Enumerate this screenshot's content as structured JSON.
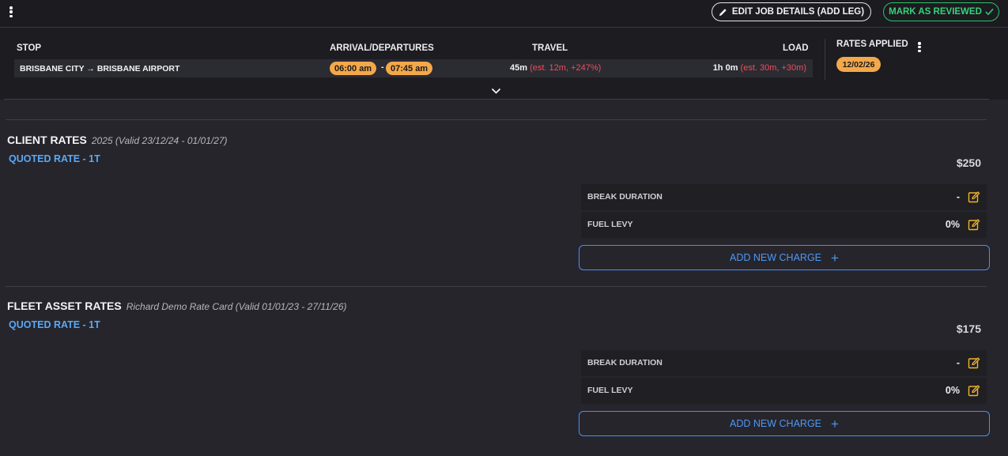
{
  "toolbar": {
    "edit_label": "EDIT JOB DETAILS (ADD LEG)",
    "review_label": "MARK AS REVIEWED"
  },
  "summary": {
    "headers": {
      "stop": "STOP",
      "arrival": "ARRIVAL/DEPARTURES",
      "travel": "TRAVEL",
      "load": "LOAD",
      "rates_applied": "RATES APPLIED"
    },
    "leg": {
      "stop": "BRISBANE CITY → BRISBANE AIRPORT",
      "arrival": "06:00 am",
      "separator": "-",
      "departure": "07:45 am",
      "travel_time": "45m",
      "travel_est": "(est. 12m, +247%)",
      "load_time": "1h 0m",
      "load_est": "(est. 30m, +30m)"
    },
    "rate_date": "12/02/26"
  },
  "client_rates": {
    "title": "CLIENT RATES",
    "meta": "2025   (Valid 23/12/24 - 01/01/27)",
    "quoted": "QUOTED RATE - 1T",
    "price": "$250",
    "charges": [
      {
        "label": "BREAK DURATION",
        "value": "-"
      },
      {
        "label": "FUEL LEVY",
        "value": "0%"
      }
    ],
    "add_label": "ADD NEW CHARGE"
  },
  "fleet_rates": {
    "title": "FLEET ASSET RATES",
    "meta": "Richard Demo Rate Card   (Valid 01/01/23 - 27/11/26)",
    "quoted": "QUOTED RATE - 1T",
    "price": "$175",
    "charges": [
      {
        "label": "BREAK DURATION",
        "value": "-"
      },
      {
        "label": "FUEL LEVY",
        "value": "0%"
      }
    ],
    "add_label": "ADD NEW CHARGE"
  },
  "colors": {
    "accent_blue": "#4d98f5",
    "pill_orange": "#f3a84a",
    "review_green": "#37d27a",
    "warning_red": "#ef4d5b",
    "edit_icon_yellow": "#f0b429"
  }
}
